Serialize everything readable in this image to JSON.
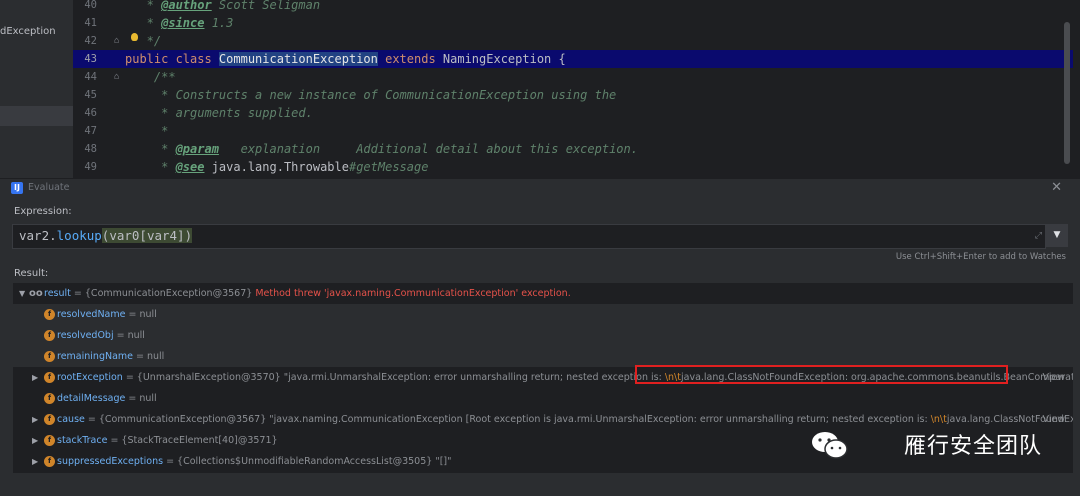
{
  "left_panel": {
    "label": "dException"
  },
  "editor": {
    "lines": [
      {
        "num": "40",
        "parts": [
          [
            "cmt",
            "   * "
          ],
          [
            "tag",
            "@author"
          ],
          [
            "cmt",
            " Scott Seligman"
          ]
        ]
      },
      {
        "num": "41",
        "parts": [
          [
            "cmt",
            "   * "
          ],
          [
            "tag",
            "@since"
          ],
          [
            "cmt",
            " 1.3"
          ]
        ]
      },
      {
        "num": "42",
        "parts": [
          [
            "cmt",
            "   */"
          ]
        ]
      },
      {
        "num": "43",
        "parts": [
          [
            "kw",
            "public class "
          ],
          [
            "hl",
            "CommunicationException"
          ],
          [
            "kw",
            " extends "
          ],
          [
            "cls",
            "NamingException {"
          ]
        ]
      },
      {
        "num": "44",
        "parts": [
          [
            "cmt",
            "    /**"
          ]
        ]
      },
      {
        "num": "45",
        "parts": [
          [
            "cmt",
            "     * Constructs a new instance of CommunicationException using the"
          ]
        ]
      },
      {
        "num": "46",
        "parts": [
          [
            "cmt",
            "     * arguments supplied."
          ]
        ]
      },
      {
        "num": "47",
        "parts": [
          [
            "cmt",
            "     *"
          ]
        ]
      },
      {
        "num": "48",
        "parts": [
          [
            "cmt",
            "     * "
          ],
          [
            "tag",
            "@param"
          ],
          [
            "cmt",
            "   explanation     Additional detail about this exception."
          ]
        ]
      },
      {
        "num": "49",
        "parts": [
          [
            "cmt",
            "     * "
          ],
          [
            "tag",
            "@see"
          ],
          [
            "cls",
            " java.lang.Throwable"
          ],
          [
            "cmt",
            "#getMessage"
          ]
        ]
      }
    ]
  },
  "dialog": {
    "title": "Evaluate",
    "expression_label": "Expression:",
    "expression": {
      "pre": "var2.",
      "method": "lookup",
      "arg": "(var0[var4])"
    },
    "hint": "Use Ctrl+Shift+Enter to add to Watches",
    "result_label": "Result:"
  },
  "result_tree": [
    {
      "kind": "root",
      "name": "result",
      "value": " = {CommunicationException@3567} ",
      "error": "Method threw 'javax.naming.CommunicationException' exception."
    },
    {
      "kind": "field",
      "name": "resolvedName",
      "value": " = null"
    },
    {
      "kind": "field",
      "name": "resolvedObj",
      "value": " = null"
    },
    {
      "kind": "field",
      "name": "remainingName",
      "value": " = null"
    },
    {
      "kind": "expand",
      "name": "rootException",
      "value": " = {UnmarshalException@3570} \"java.rmi.UnmarshalException: error unmarshalling return; nested exception is: ",
      "esc": "\\n\\t",
      "tail": "java.lang.ClassNotFoundException: org.apache.commons.beanutils.BeanComparator (no secur...",
      "view": "View"
    },
    {
      "kind": "field",
      "name": "detailMessage",
      "value": " = null"
    },
    {
      "kind": "expand",
      "name": "cause",
      "value": " = {CommunicationException@3567} \"javax.naming.CommunicationException [Root exception is java.rmi.UnmarshalException: error unmarshalling return; nested exception is: ",
      "esc": "\\n\\t",
      "tail": "java.lang.ClassNotFoundException: org....",
      "view": "View"
    },
    {
      "kind": "expand",
      "name": "stackTrace",
      "value": " = {StackTraceElement[40]@3571}"
    },
    {
      "kind": "expand",
      "name": "suppressedExceptions",
      "value": " = {Collections$UnmodifiableRandomAccessList@3505} \"[]\""
    }
  ],
  "watermark": "雁行安全团队",
  "colors": {
    "highlight_box": "#e02020",
    "current_line": "#0a0a6e",
    "accent": "#3574f0"
  }
}
